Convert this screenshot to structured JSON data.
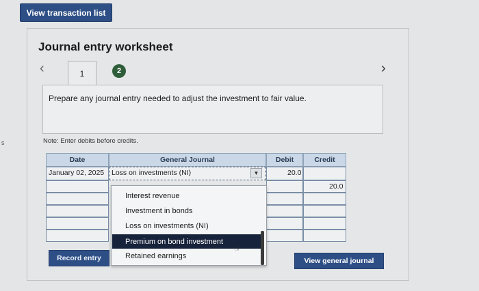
{
  "margin_mark": "s",
  "top_button": "View transaction list",
  "worksheet": {
    "title": "Journal entry worksheet",
    "tabs": [
      "1",
      "2"
    ],
    "prompt": "Prepare any journal entry needed to adjust the investment to fair value.",
    "note": "Note: Enter debits before credits."
  },
  "table": {
    "headers": {
      "date": "Date",
      "journal": "General Journal",
      "debit": "Debit",
      "credit": "Credit"
    },
    "row1": {
      "date": "January 02, 2025",
      "account": "Loss on investments (NI)",
      "debit": "20.0",
      "credit": ""
    },
    "row2": {
      "credit": "20.0"
    }
  },
  "dropdown": {
    "options": [
      "Interest revenue",
      "Investment in bonds",
      "Loss on investments (NI)",
      "Premium on bond investment",
      "Retained earnings"
    ],
    "highlighted": "Premium on bond investment"
  },
  "buttons": {
    "record": "Record entry",
    "view_journal": "View general journal"
  },
  "colors": {
    "primary": "#2e4f86",
    "header_bg": "#c9d7e6",
    "highlight": "#17233a",
    "tab_active": "#2f5d3a"
  }
}
